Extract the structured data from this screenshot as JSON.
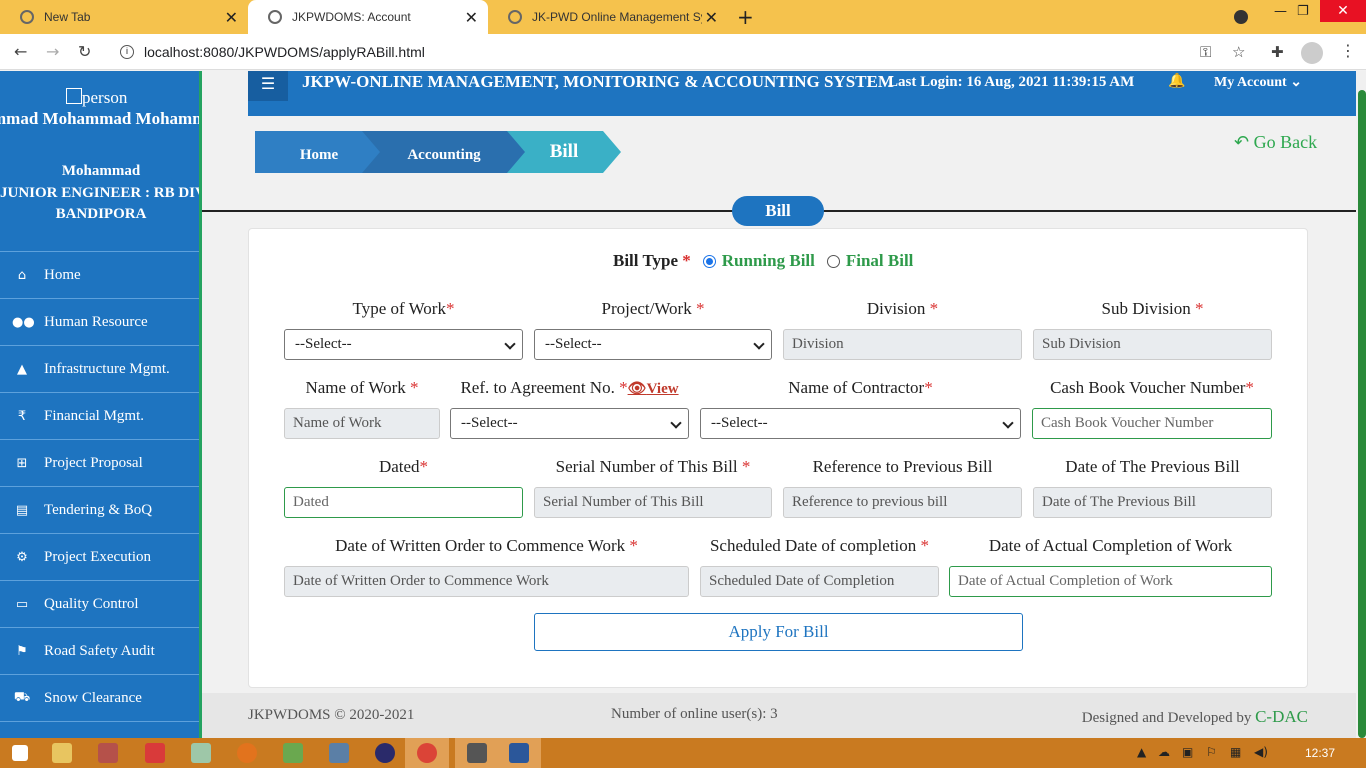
{
  "browser": {
    "tabs": [
      {
        "title": "New Tab"
      },
      {
        "title": "JKPWDOMS: Account"
      },
      {
        "title": "JK-PWD Online Management Sys"
      }
    ],
    "url": "localhost:8080/JKPWDOMS/applyRABill.html"
  },
  "sidebar": {
    "person_label": "person",
    "user_name": "mmad Mohammad Mohammad",
    "user_short": "Mohammad",
    "designation": "JUNIOR ENGINEER : RB DIVI",
    "place": "BANDIPORA",
    "items": [
      {
        "label": "Home",
        "icon": "home-icon"
      },
      {
        "label": "Human Resource",
        "icon": "users-icon"
      },
      {
        "label": "Infrastructure Mgmt.",
        "icon": "road-icon"
      },
      {
        "label": "Financial Mgmt.",
        "icon": "rupee-icon"
      },
      {
        "label": "Project Proposal",
        "icon": "sitemap-icon"
      },
      {
        "label": "Tendering & BoQ",
        "icon": "document-icon"
      },
      {
        "label": "Project Execution",
        "icon": "cogs-icon"
      },
      {
        "label": "Quality Control",
        "icon": "desktop-icon"
      },
      {
        "label": "Road Safety Audit",
        "icon": "flag-icon"
      },
      {
        "label": "Snow Clearance",
        "icon": "snowplow-icon"
      }
    ]
  },
  "header": {
    "title": "JKPW-ONLINE MANAGEMENT, MONITORING & ACCOUNTING SYSTEM",
    "last_login": "Last Login: 16 Aug, 2021 11:39:15 AM",
    "my_account": "My Account"
  },
  "breadcrumb": {
    "home": "Home",
    "accounting": "Accounting",
    "bill": "Bill"
  },
  "go_back": "Go Back",
  "section_title": "Bill",
  "form": {
    "bill_type_label": "Bill Type",
    "bill_type_options": [
      {
        "label": "Running Bill",
        "checked": true
      },
      {
        "label": "Final Bill",
        "checked": false
      }
    ],
    "type_of_work": {
      "label": "Type of Work",
      "value": "--Select--"
    },
    "project_work": {
      "label": "Project/Work",
      "value": "--Select--"
    },
    "division": {
      "label": "Division",
      "placeholder": "Division"
    },
    "sub_division": {
      "label": "Sub Division",
      "placeholder": "Sub Division"
    },
    "name_of_work": {
      "label": "Name of Work",
      "placeholder": "Name of Work"
    },
    "ref_agreement": {
      "label": "Ref. to Agreement No.",
      "view_label": "View",
      "value": "--Select--"
    },
    "contractor": {
      "label": "Name of Contractor",
      "value": "--Select--"
    },
    "cash_book": {
      "label": "Cash Book Voucher Number",
      "placeholder": "Cash Book Voucher Number"
    },
    "dated": {
      "label": "Dated",
      "placeholder": "Dated"
    },
    "serial_number": {
      "label": "Serial Number of This Bill",
      "placeholder": "Serial Number of This Bill"
    },
    "ref_prev_bill": {
      "label": "Reference to Previous Bill",
      "placeholder": "Reference to previous bill"
    },
    "date_prev_bill": {
      "label": "Date of The Previous Bill",
      "placeholder": "Date of The Previous Bill"
    },
    "written_order_date": {
      "label": "Date of Written Order to Commence Work",
      "placeholder": "Date of Written Order to Commence Work"
    },
    "scheduled_completion": {
      "label": "Scheduled Date of completion",
      "placeholder": "Scheduled Date of Completion"
    },
    "actual_completion": {
      "label": "Date of Actual Completion of Work",
      "placeholder": "Date of Actual Completion of Work"
    },
    "apply_button": "Apply For Bill"
  },
  "footer": {
    "copyright": "JKPWDOMS © 2020-2021",
    "online_users": "Number of online user(s): 3",
    "designed_by": "Designed and Developed by",
    "developer": "C-DAC"
  },
  "taskbar": {
    "clock": "12:37"
  },
  "colors": {
    "primary": "#1e74c0",
    "accent_green": "#2e9a4a",
    "required": "#d9302f",
    "browser_tab": "#f5c24d",
    "taskbar": "#c97a20"
  }
}
